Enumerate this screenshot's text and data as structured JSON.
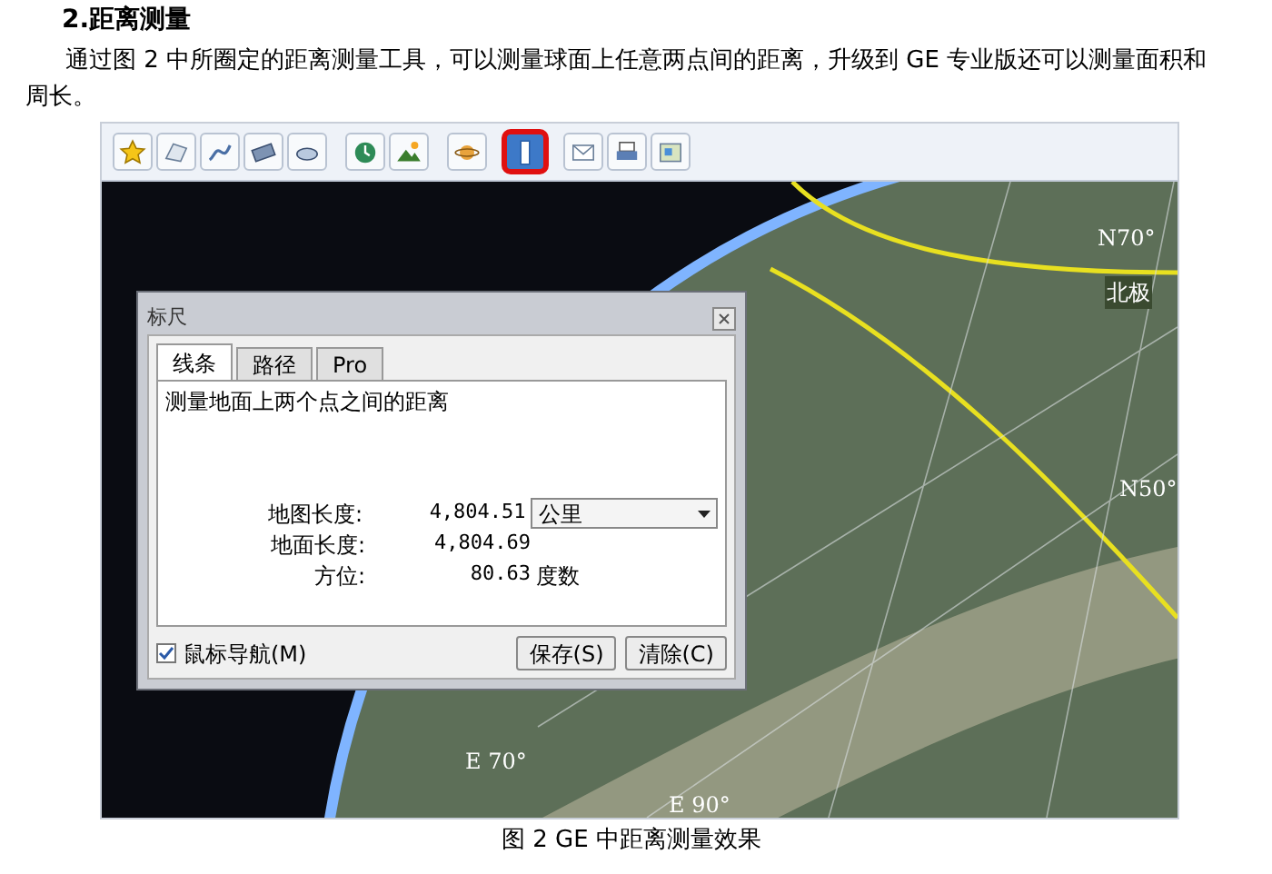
{
  "heading": "2.距离测量",
  "paragraph": "通过图 2 中所圈定的距离测量工具，可以测量球面上任意两点间的距离，升级到 GE 专业版还可以测量面积和周长。",
  "screenshot": {
    "toolbar": [
      {
        "highlighted": false
      },
      {
        "highlighted": false
      },
      {
        "highlighted": false
      },
      {
        "highlighted": false
      },
      {
        "highlighted": false
      },
      {
        "highlighted": false
      },
      {
        "highlighted": false
      },
      {
        "highlighted": false
      },
      {
        "highlighted": true
      },
      {
        "highlighted": false
      },
      {
        "highlighted": false
      },
      {
        "highlighted": false
      }
    ],
    "map_labels": [
      "N70°",
      "北极",
      "N50°",
      "E 70°",
      "E 90°"
    ],
    "dialog": {
      "title": "标尺",
      "tabs": [
        {
          "label": "线条",
          "selected": true
        },
        {
          "label": "路径",
          "selected": false
        },
        {
          "label": "Pro",
          "selected": false
        }
      ],
      "description": "测量地面上两个点之间的距离",
      "rows": [
        {
          "label": "地图长度:",
          "value": "4,804.51",
          "unit_select": "公里"
        },
        {
          "label": "地面长度:",
          "value": "4,804.69"
        },
        {
          "label": "方位:",
          "value": "80.63",
          "unit": "度数"
        }
      ],
      "checkbox": {
        "label": "鼠标导航(M)",
        "checked": true
      },
      "buttons": [
        "保存(S)",
        "清除(C)"
      ]
    }
  },
  "caption": "图 2 GE 中距离测量效果"
}
